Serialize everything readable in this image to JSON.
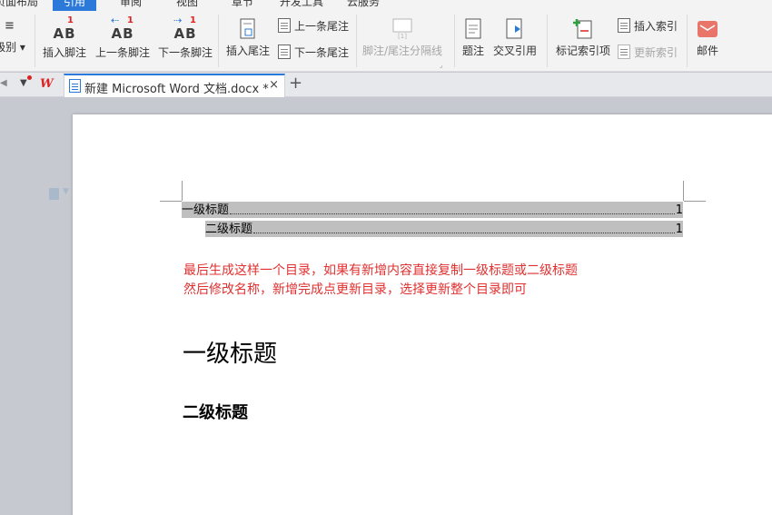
{
  "menu": {
    "tabs": [
      "页面布局",
      "引用",
      "审阅",
      "视图",
      "章节",
      "开发工具",
      "云服务"
    ],
    "active": "引用"
  },
  "ribbon": {
    "level_label": "级别",
    "insert_footnote": "插入脚注",
    "prev_footnote": "上一条脚注",
    "next_footnote": "下一条脚注",
    "insert_endnote": "插入尾注",
    "prev_endnote": "上一条尾注",
    "next_endnote": "下一条尾注",
    "footnote_separator": "脚注/尾注分隔线",
    "caption": "题注",
    "cross_reference": "交叉引用",
    "mark_index_entry": "标记索引项",
    "insert_index": "插入索引",
    "update_index": "更新索引",
    "mail": "邮件",
    "ab_text": "AB",
    "footnote_mark": "1",
    "separator_mark": "[1]"
  },
  "tabbar": {
    "document_title": "新建 Microsoft Word 文档.docx *",
    "close_glyph": "×",
    "new_tab_glyph": "+",
    "logo_text": "W"
  },
  "document": {
    "toc": [
      {
        "text": "一级标题",
        "page": "1"
      },
      {
        "text": "二级标题",
        "page": "1"
      }
    ],
    "note_lines": [
      "最后生成这样一个目录，如果有新增内容直接复制一级标题或二级标题",
      "然后修改名称，新增完成点更新目录，选择更新整个目录即可"
    ],
    "heading1": "一级标题",
    "heading2": "二级标题"
  },
  "colors": {
    "accent": "#2b79d8",
    "note_red": "#e03030",
    "toc_highlight": "#bfbfbf"
  }
}
